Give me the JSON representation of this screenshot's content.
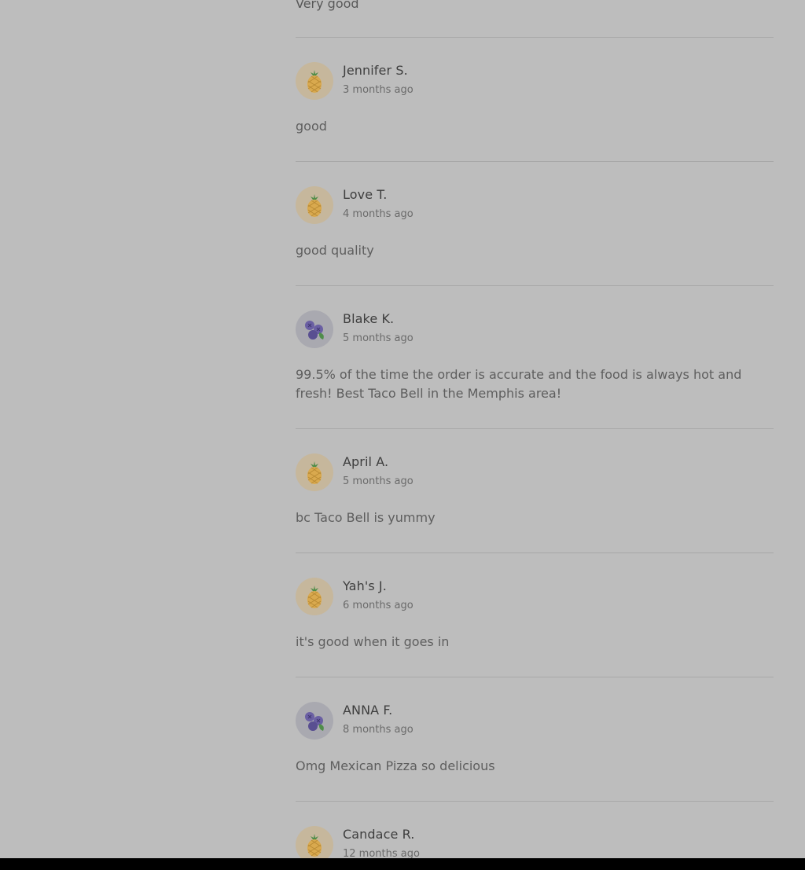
{
  "top_comment": "Very good",
  "reviews": [
    {
      "name": "Jennifer S.",
      "time": "3 months ago",
      "comment": "good",
      "avatar": "pineapple-icon"
    },
    {
      "name": "Love T.",
      "time": "4 months ago",
      "comment": "good quality",
      "avatar": "pineapple-icon"
    },
    {
      "name": "Blake K.",
      "time": "5 months ago",
      "comment": "99.5% of the time the order is accurate and the food is always hot and fresh! Best Taco Bell in the Memphis area!",
      "avatar": "blueberry-icon"
    },
    {
      "name": "April A.",
      "time": "5 months ago",
      "comment": "bc Taco Bell is yummy",
      "avatar": "pineapple-icon"
    },
    {
      "name": "Yah's J.",
      "time": "6 months ago",
      "comment": "it's good when it goes in",
      "avatar": "pineapple-icon"
    },
    {
      "name": "ANNA F.",
      "time": "8 months ago",
      "comment": "Omg Mexican Pizza so delicious",
      "avatar": "blueberry-icon"
    },
    {
      "name": "Candace R.",
      "time": "12 months ago",
      "comment": "",
      "avatar": "pineapple-icon"
    }
  ],
  "colors": {
    "overlay_background": "#bdbdbd",
    "divider": "#a8a8a8",
    "name_text": "#3e3e3e",
    "comment_text": "#5e5e5e"
  }
}
